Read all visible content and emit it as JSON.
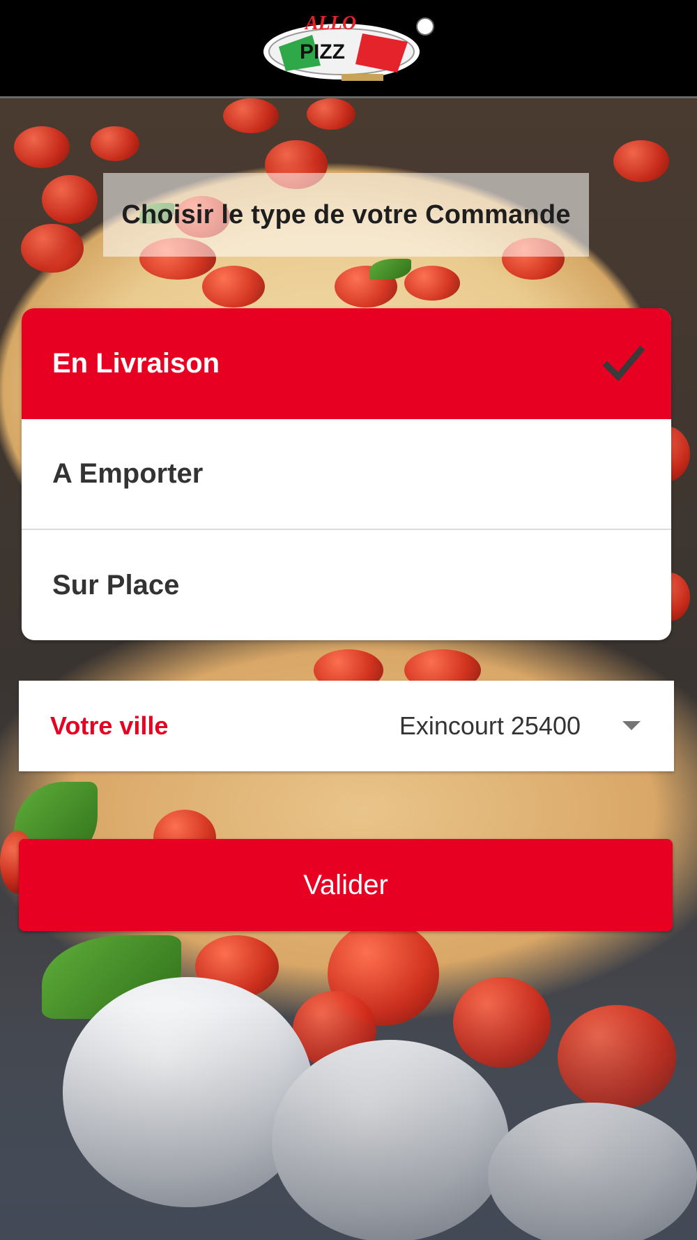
{
  "header": {
    "logo_text_top": "ALLO",
    "logo_text_main": "PIZZ"
  },
  "order_type": {
    "instruction": "Choisir le type de votre Commande",
    "options": [
      {
        "label": "En Livraison",
        "selected": true
      },
      {
        "label": "A Emporter",
        "selected": false
      },
      {
        "label": "Sur Place",
        "selected": false
      }
    ]
  },
  "city": {
    "label": "Votre ville",
    "value": "Exincourt 25400"
  },
  "actions": {
    "validate_label": "Valider"
  },
  "colors": {
    "accent": "#e70022",
    "header_bg": "#000000",
    "text_dark": "#333333"
  }
}
